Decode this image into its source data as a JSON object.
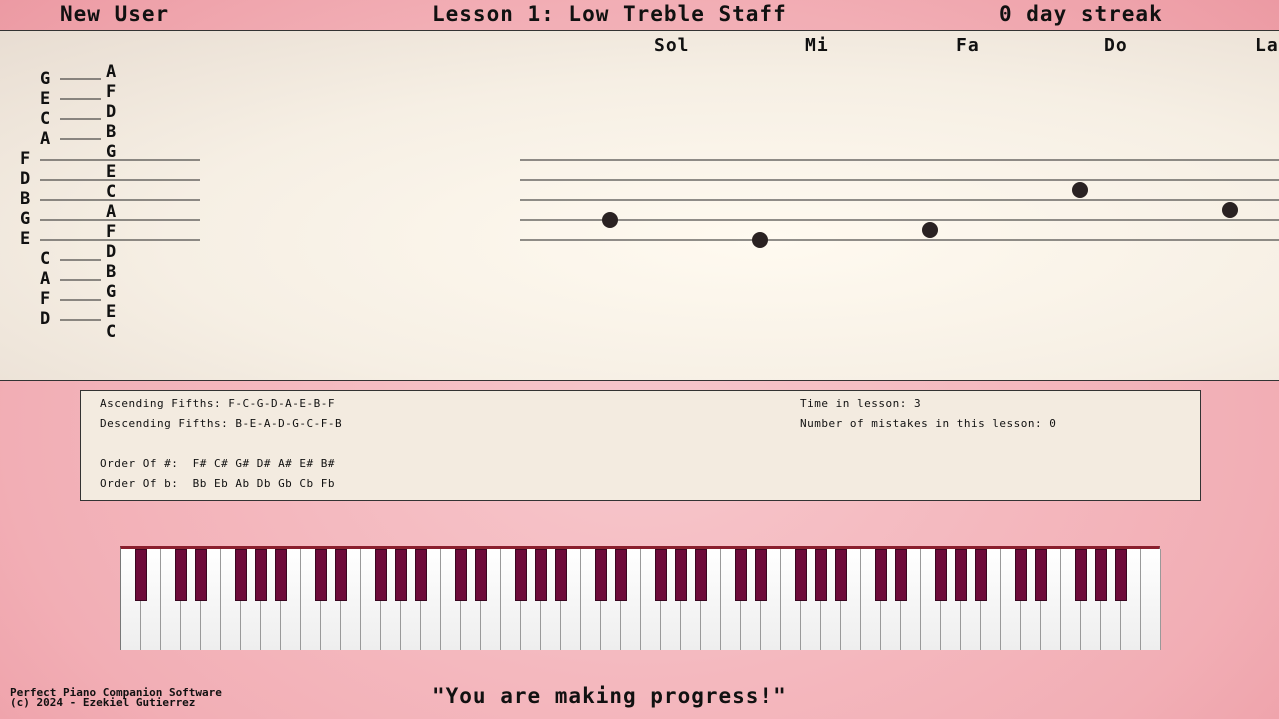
{
  "header": {
    "user": "New User",
    "lesson_title": "Lesson 1: Low Treble Staff",
    "streak": "0 day streak"
  },
  "legend": {
    "upper_left": [
      "G",
      "E",
      "C",
      "A"
    ],
    "upper_right": [
      "A",
      "F",
      "D",
      "B"
    ],
    "staff_left": [
      "F",
      "D",
      "B",
      "G",
      "E"
    ],
    "staff_right": [
      "G",
      "E",
      "C",
      "A",
      "F"
    ],
    "lower_left": [
      "C",
      "A",
      "F",
      "D"
    ],
    "lower_right": [
      "D",
      "B",
      "G",
      "E",
      "C"
    ]
  },
  "exercise": {
    "solfege": [
      "Sol",
      "Mi",
      "Fa",
      "Do",
      "La"
    ]
  },
  "info": {
    "ascending_fifths": "Ascending Fifths: F-C-G-D-A-E-B-F",
    "descending_fifths": "Descending Fifths: B-E-A-D-G-C-F-B",
    "order_sharps": "Order Of #:  F# C# G# D# A# E# B#",
    "order_flats": "Order Of b:  Bb Eb Ab Db Gb Cb Fb",
    "time_in_lesson": "Time in lesson: 3",
    "mistakes": "Number of mistakes in this lesson: 0"
  },
  "keyboard": {
    "white_key_count": 52,
    "accent": "#6e0b3a"
  },
  "footer": {
    "credit_line1": "Perfect Piano Companion Software",
    "credit_line2": "(c) 2024 - Ezekiel Gutierrez",
    "message": "\"You are making progress!\""
  }
}
